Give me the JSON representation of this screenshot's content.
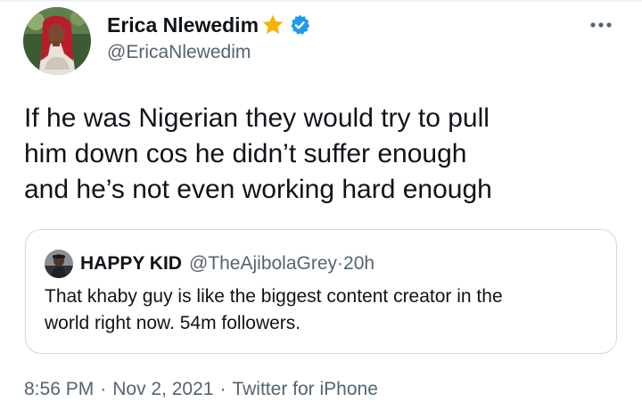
{
  "tweet": {
    "author": {
      "display_name": "Erica Nlewedim",
      "handle": "@EricaNlewedim",
      "name_emoji_icon": "star-icon",
      "verified_icon": "verified-badge-icon",
      "avatar": "profile-photo"
    },
    "more_icon": "more-options-icon",
    "text_lines": [
      "If he was Nigerian they would try to pull",
      "him down cos he didn’t suffer enough",
      "and he’s not even working hard enough"
    ],
    "quoted": {
      "display_name": "HAPPY KID",
      "handle": "@TheAjibolaGrey",
      "separator": "·",
      "age": "20h",
      "text_lines": [
        "That khaby guy is like the biggest content creator in the",
        "world right now. 54m followers."
      ]
    },
    "meta": {
      "time": "8:56 PM",
      "date": "Nov 2, 2021",
      "source": "Twitter for iPhone",
      "separator": "·"
    }
  },
  "colors": {
    "text_primary": "#0f1419",
    "text_secondary": "#536471",
    "verified_blue": "#1d9bf0",
    "star_gold": "#f4b400",
    "border": "#cfd9de"
  }
}
